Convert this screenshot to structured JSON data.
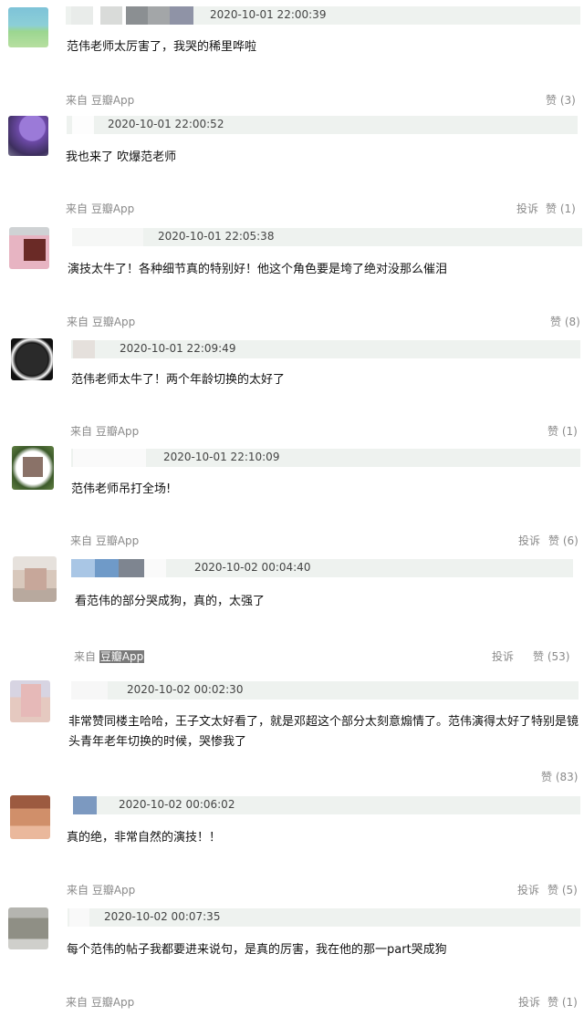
{
  "comments": [
    {
      "time": "2020-10-01 22:00:39",
      "text": "范伟老师太厉害了，我哭的稀里哗啦",
      "source_prefix": "来自",
      "source_app": "豆瓣App",
      "report": "",
      "like": "赞 (3)"
    },
    {
      "time": "2020-10-01 22:00:52",
      "text": "我也来了 吹爆范老师",
      "source_prefix": "来自",
      "source_app": "豆瓣App",
      "report": "投诉",
      "like": "赞 (1)"
    },
    {
      "time": "2020-10-01 22:05:38",
      "text": "演技太牛了！各种细节真的特别好！他这个角色要是垮了绝对没那么催泪",
      "source_prefix": "来自",
      "source_app": "豆瓣App",
      "report": "",
      "like": "赞 (8)"
    },
    {
      "time": "2020-10-01 22:09:49",
      "text": "范伟老师太牛了！两个年龄切换的太好了",
      "source_prefix": "来自",
      "source_app": "豆瓣App",
      "report": "",
      "like": "赞 (1)"
    },
    {
      "time": "2020-10-01 22:10:09",
      "text": "范伟老师吊打全场!",
      "source_prefix": "来自",
      "source_app": "豆瓣App",
      "report": "投诉",
      "like": "赞 (6)"
    },
    {
      "time": "2020-10-02 00:04:40",
      "text": "看范伟的部分哭成狗，真的，太强了",
      "source_prefix": "来自",
      "source_app": "豆瓣App",
      "report": "投诉",
      "like": "赞 (53)"
    },
    {
      "time": "2020-10-02 00:02:30",
      "text_line1": "非常赞同楼主哈哈，王子文太好看了，就是邓超这个部分太刻意煽情了。范伟演得太好了特别是镜",
      "text_line2": "头青年老年切换的时候，哭惨我了",
      "source_prefix": "",
      "source_app": "",
      "report": "",
      "like": "赞 (83)"
    },
    {
      "time": "2020-10-02 00:06:02",
      "text": "真的绝，非常自然的演技！！",
      "source_prefix": "来自",
      "source_app": "豆瓣App",
      "report": "投诉",
      "like": "赞 (5)"
    },
    {
      "time": "2020-10-02 00:07:35",
      "text": "每个范伟的帖子我都要进来说句，是真的厉害，我在他的那一part哭成狗",
      "source_prefix": "来自",
      "source_app": "豆瓣App",
      "report": "投诉",
      "like": "赞 (1)"
    }
  ],
  "colors": {
    "header_bar": "#eef2ef",
    "meta_text": "#8a8a8a",
    "body_text": "#111111"
  }
}
